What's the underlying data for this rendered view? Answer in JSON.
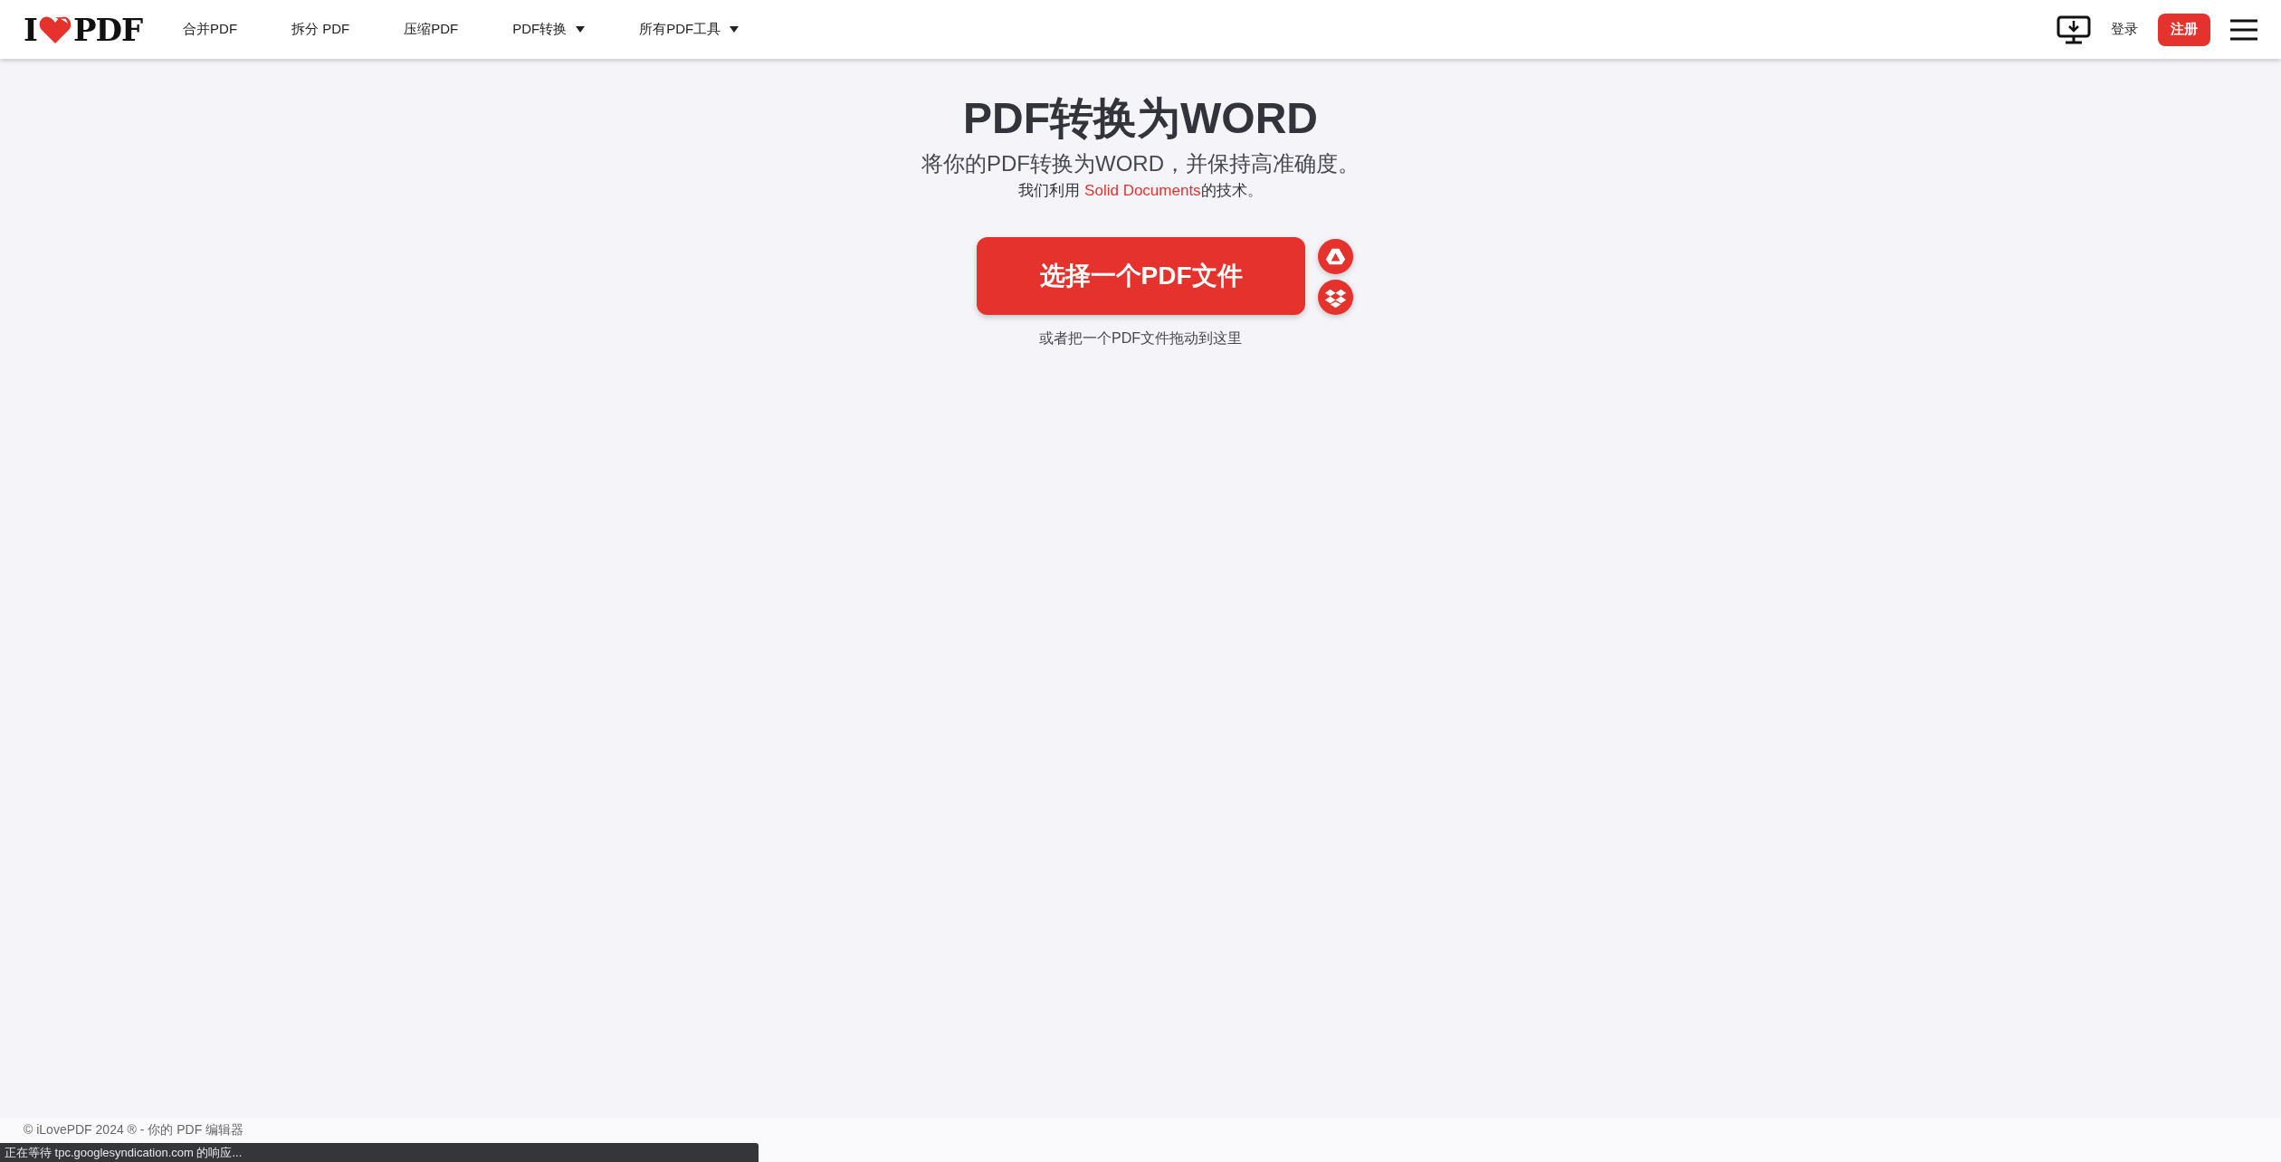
{
  "header": {
    "logo": {
      "left": "I",
      "right": "PDF"
    },
    "nav": [
      {
        "label": "合并PDF",
        "dropdown": false
      },
      {
        "label": "拆分 PDF",
        "dropdown": false
      },
      {
        "label": "压缩PDF",
        "dropdown": false
      },
      {
        "label": "PDF转换",
        "dropdown": true
      },
      {
        "label": "所有PDF工具",
        "dropdown": true
      }
    ],
    "login": "登录",
    "signup": "注册"
  },
  "hero": {
    "title": "PDF转换为WORD",
    "subtitle": "将你的PDF转换为WORD，并保持高准确度。",
    "tech_prefix": "我们利用 ",
    "tech_link": "Solid Documents",
    "tech_suffix": "的技术。",
    "upload_button": "选择一个PDF文件",
    "drop_hint": "或者把一个PDF文件拖动到这里"
  },
  "footer": {
    "copyright": "© iLovePDF 2024 ® - 你的 PDF 编辑器"
  },
  "status_bar": "正在等待 tpc.googlesyndication.com 的响应..."
}
